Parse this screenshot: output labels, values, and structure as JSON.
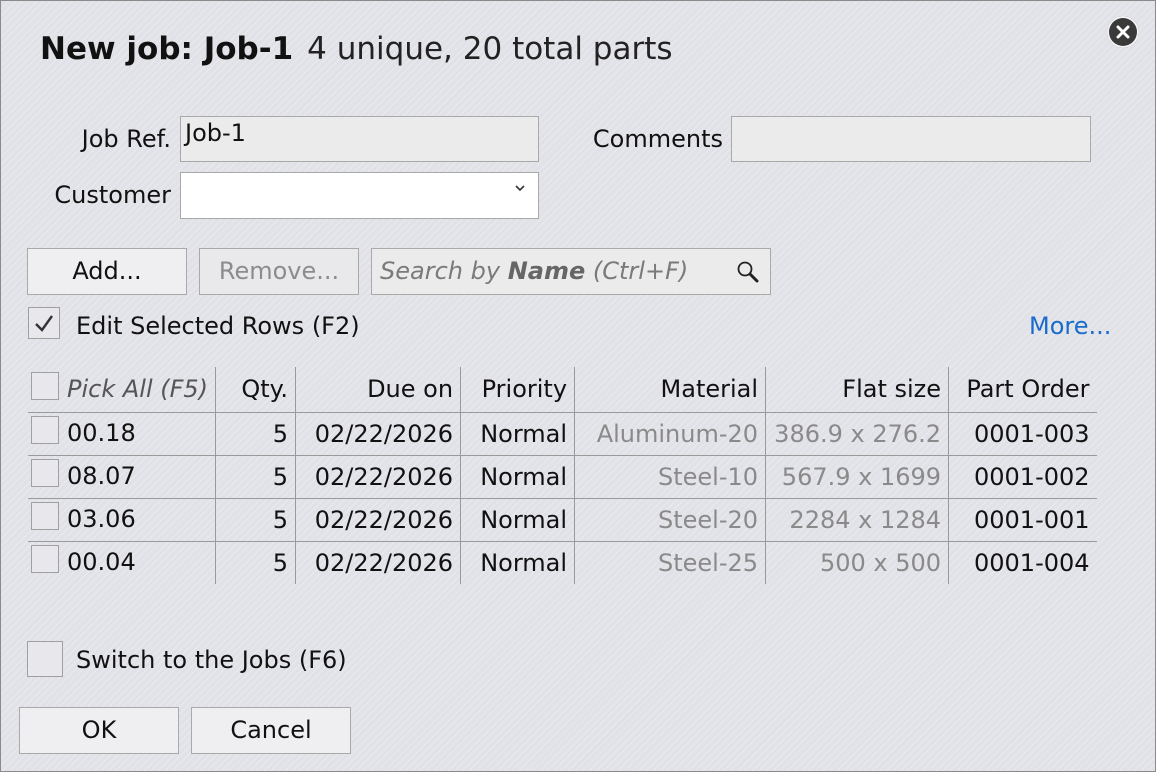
{
  "dialog": {
    "title": "New job: Job-1",
    "subtitle": "4 unique, 20 total parts"
  },
  "form": {
    "job_ref_label": "Job Ref.",
    "job_ref_value": "Job-1",
    "comments_label": "Comments",
    "comments_value": "",
    "customer_label": "Customer",
    "customer_value": ""
  },
  "toolbar": {
    "add_label": "Add...",
    "remove_label": "Remove...",
    "search_prefix": "Search by ",
    "search_bold": "Name",
    "search_suffix": " (Ctrl+F)"
  },
  "edit_selected": {
    "label": "Edit Selected Rows (F2)",
    "checked": true
  },
  "more_link": "More...",
  "table": {
    "columns": [
      "Pick All (F5)",
      "Qty.",
      "Due on",
      "Priority",
      "Material",
      "Flat size",
      "Part Order"
    ],
    "rows": [
      {
        "name": "00.18",
        "qty": "5",
        "due": "02/22/2026",
        "priority": "Normal",
        "material": "Aluminum-20",
        "flat_size": "386.9 x 276.2",
        "part_order": "0001-003"
      },
      {
        "name": "08.07",
        "qty": "5",
        "due": "02/22/2026",
        "priority": "Normal",
        "material": "Steel-10",
        "flat_size": "567.9 x 1699",
        "part_order": "0001-002"
      },
      {
        "name": "03.06",
        "qty": "5",
        "due": "02/22/2026",
        "priority": "Normal",
        "material": "Steel-20",
        "flat_size": "2284 x 1284",
        "part_order": "0001-001"
      },
      {
        "name": "00.04",
        "qty": "5",
        "due": "02/22/2026",
        "priority": "Normal",
        "material": "Steel-25",
        "flat_size": "500 x 500",
        "part_order": "0001-004"
      }
    ]
  },
  "switch_jobs": {
    "label": "Switch to the Jobs (F6)",
    "checked": false
  },
  "buttons": {
    "ok_label": "OK",
    "cancel_label": "Cancel"
  },
  "colors": {
    "link": "#1a6ccb",
    "background": "#e1e1e8"
  },
  "icons": {
    "close": "close-icon",
    "search": "search-icon",
    "dropdown": "chevron-down-icon",
    "check": "checkmark-icon"
  }
}
